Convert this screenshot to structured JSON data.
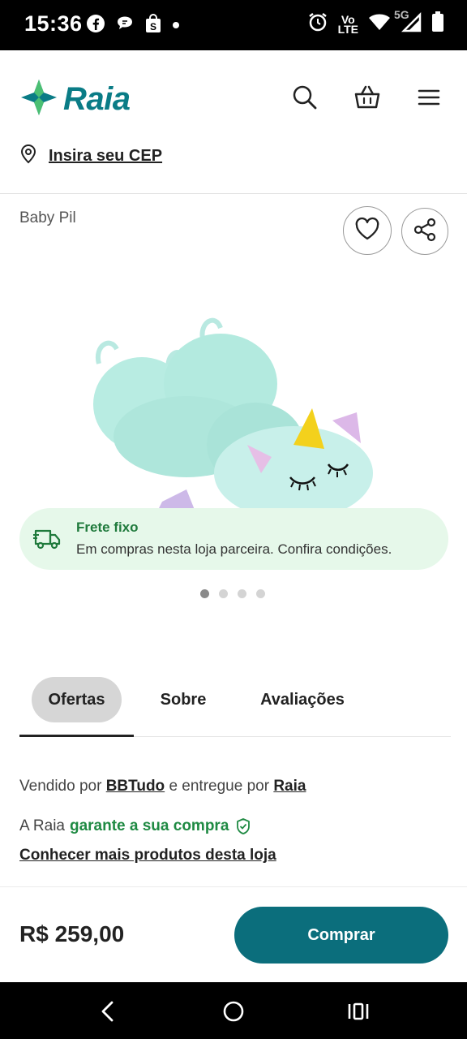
{
  "status_bar": {
    "time": "15:36",
    "volte_top": "Vo",
    "volte_bottom": "LTE",
    "network": "5G",
    "icons_left": [
      "facebook-icon",
      "chat-icon",
      "shopping-bag-icon",
      "dot-icon"
    ],
    "icons_right": [
      "alarm-icon",
      "volte-icon",
      "wifi-icon",
      "signal-icon",
      "battery-icon"
    ]
  },
  "header": {
    "logo_text": "Raia",
    "cep_label": "Insira seu CEP",
    "icons": [
      "search-icon",
      "basket-icon",
      "menu-icon"
    ]
  },
  "product": {
    "brand": "Baby Pil",
    "image_alt": "unicorn baby bath pillow"
  },
  "frete": {
    "title": "Frete fixo",
    "description": "Em compras nesta loja parceira. Confira condições."
  },
  "carousel": {
    "total": 4,
    "active": 1
  },
  "tabs": [
    {
      "label": "Ofertas",
      "active": true
    },
    {
      "label": "Sobre",
      "active": false
    },
    {
      "label": "Avaliações",
      "active": false
    }
  ],
  "seller": {
    "sold_by_prefix": "Vendido por",
    "seller_name": "BBTudo",
    "delivered_by_prefix": "e entregue por",
    "delivered_by": "Raia",
    "guarantee_prefix": "A Raia",
    "guarantee_text": "garante a sua compra",
    "more_products": "Conhecer mais produtos desta loja"
  },
  "purchase": {
    "price": "R$ 259,00",
    "buy_label": "Comprar"
  },
  "colors": {
    "brand_teal": "#0a7c86",
    "buy_button": "#0b6e7c",
    "frete_bg": "#e6f8ea",
    "guarantee_green": "#1f8a43"
  }
}
